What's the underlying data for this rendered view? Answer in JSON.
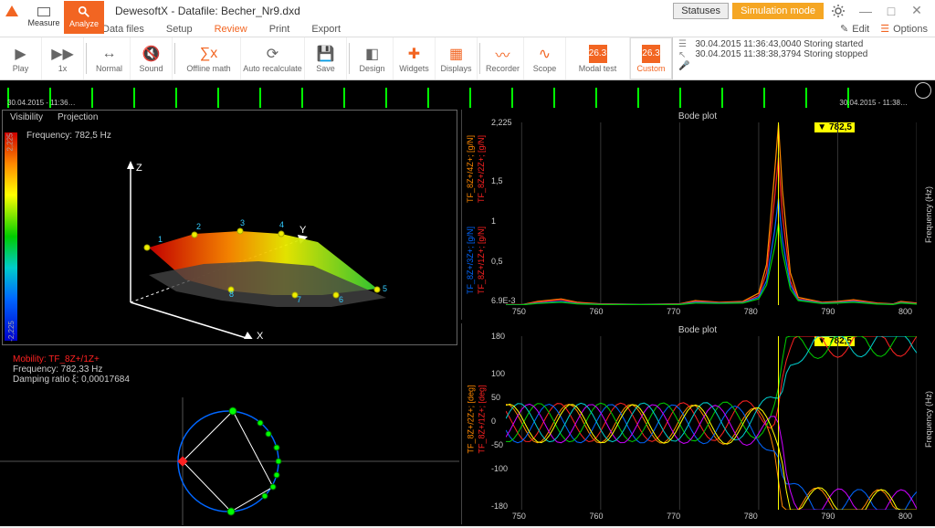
{
  "app": {
    "title": "DewesoftX - Datafile: Becher_Nr9.dxd"
  },
  "titlebar": {
    "statuses": "Statuses",
    "sim_mode": "Simulation mode"
  },
  "tabs": {
    "measure": "Measure",
    "analyze": "Analyze"
  },
  "menu": {
    "datafiles": "Data files",
    "setup": "Setup",
    "review": "Review",
    "print": "Print",
    "export": "Export",
    "edit": "Edit",
    "options": "Options"
  },
  "toolbar": {
    "play": "Play",
    "speed": "1x",
    "normal": "Normal",
    "sound": "Sound",
    "offline": "Offline math",
    "auto": "Auto recalculate",
    "save": "Save",
    "design": "Design",
    "widgets": "Widgets",
    "displays": "Displays",
    "recorder": "Recorder",
    "scope": "Scope",
    "modal": "Modal test",
    "custom": "Custom",
    "modal_val": "26.3",
    "custom_val": "26.3"
  },
  "log": {
    "line1": "30.04.2015 11:36:43,0040 Storing started",
    "line2": "30.04.2015 11:38:38,3794 Storing stopped"
  },
  "timeline": {
    "start": "30.04.2015 - 11:36…",
    "end": "30.04.2015 - 11:38…"
  },
  "viewport": {
    "tabs": {
      "visibility": "Visibility",
      "projection": "Projection"
    },
    "frequency": "Frequency: 782,5 Hz",
    "colorbar": {
      "top": "2,225",
      "bottom": "-2,225"
    },
    "axes": {
      "x": "X",
      "y": "Y",
      "z": "Z"
    },
    "nodes": [
      "1",
      "2",
      "3",
      "4",
      "5",
      "6",
      "7",
      "8"
    ]
  },
  "info": {
    "mobility": "Mobility: TF_8Z+/1Z+",
    "frequency": "Frequency: 782,33 Hz",
    "damping": "Damping ratio ξ: 0,00017684"
  },
  "chart_data": [
    {
      "type": "line",
      "title": "Bode plot",
      "marker": "782,5",
      "xlabel": "",
      "ylabel_right": "Frequency (Hz)",
      "x_ticks": [
        "750",
        "760",
        "770",
        "780",
        "790",
        "800"
      ],
      "y_ticks": [
        "6.9E-3",
        "0,5",
        "1",
        "1,5",
        "2,225"
      ],
      "series": [
        {
          "name": "TF_8Z+/4Z+; [g/N]",
          "color": "#f80"
        },
        {
          "name": "TF_8Z+/2Z+; [g/N]",
          "color": "#f22"
        },
        {
          "name": "TF_8Z+/3Z+; [g/N]",
          "color": "#06f"
        },
        {
          "name": "TF_8Z+/1Z+; [g/N]",
          "color": "#f22"
        }
      ],
      "x": [
        748,
        750,
        752,
        755,
        757,
        760,
        765,
        770,
        772,
        775,
        778,
        780,
        781,
        782,
        782.5,
        783,
        784,
        785,
        788,
        790,
        792,
        795,
        797,
        798,
        800
      ],
      "values_sets": [
        [
          0.01,
          0.01,
          0.05,
          0.08,
          0.04,
          0.02,
          0.015,
          0.02,
          0.06,
          0.04,
          0.05,
          0.15,
          0.5,
          1.6,
          2.2,
          1.4,
          0.4,
          0.1,
          0.04,
          0.05,
          0.07,
          0.03,
          0.02,
          0.05,
          0.03
        ],
        [
          0.01,
          0.01,
          0.04,
          0.07,
          0.03,
          0.018,
          0.014,
          0.018,
          0.05,
          0.035,
          0.04,
          0.12,
          0.4,
          1.3,
          1.8,
          1.1,
          0.3,
          0.08,
          0.035,
          0.04,
          0.06,
          0.025,
          0.018,
          0.04,
          0.025
        ],
        [
          0.008,
          0.009,
          0.03,
          0.05,
          0.025,
          0.015,
          0.012,
          0.015,
          0.04,
          0.03,
          0.035,
          0.1,
          0.3,
          0.9,
          1.3,
          0.8,
          0.25,
          0.07,
          0.03,
          0.035,
          0.05,
          0.02,
          0.015,
          0.035,
          0.02
        ],
        [
          0.007,
          0.008,
          0.025,
          0.04,
          0.02,
          0.012,
          0.01,
          0.012,
          0.03,
          0.025,
          0.03,
          0.08,
          0.25,
          0.7,
          1.0,
          0.65,
          0.2,
          0.06,
          0.025,
          0.03,
          0.04,
          0.018,
          0.012,
          0.03,
          0.018
        ]
      ],
      "xlim": [
        748,
        800
      ],
      "ylim": [
        0,
        2.225
      ]
    },
    {
      "type": "line",
      "title": "Bode plot",
      "marker": "782,5",
      "xlabel": "",
      "ylabel_right": "Frequency (Hz)",
      "x_ticks": [
        "750",
        "760",
        "770",
        "780",
        "790",
        "800"
      ],
      "y_ticks": [
        "-180",
        "-100",
        "-50",
        "0",
        "50",
        "100",
        "180"
      ],
      "series": [
        {
          "name": "TF_8Z+/2Z+; [deg]",
          "color": "#f80"
        },
        {
          "name": "TF_8Z+/1Z+; [deg]",
          "color": "#f22"
        }
      ],
      "xlim": [
        748,
        800
      ],
      "ylim": [
        -180,
        180
      ]
    }
  ]
}
